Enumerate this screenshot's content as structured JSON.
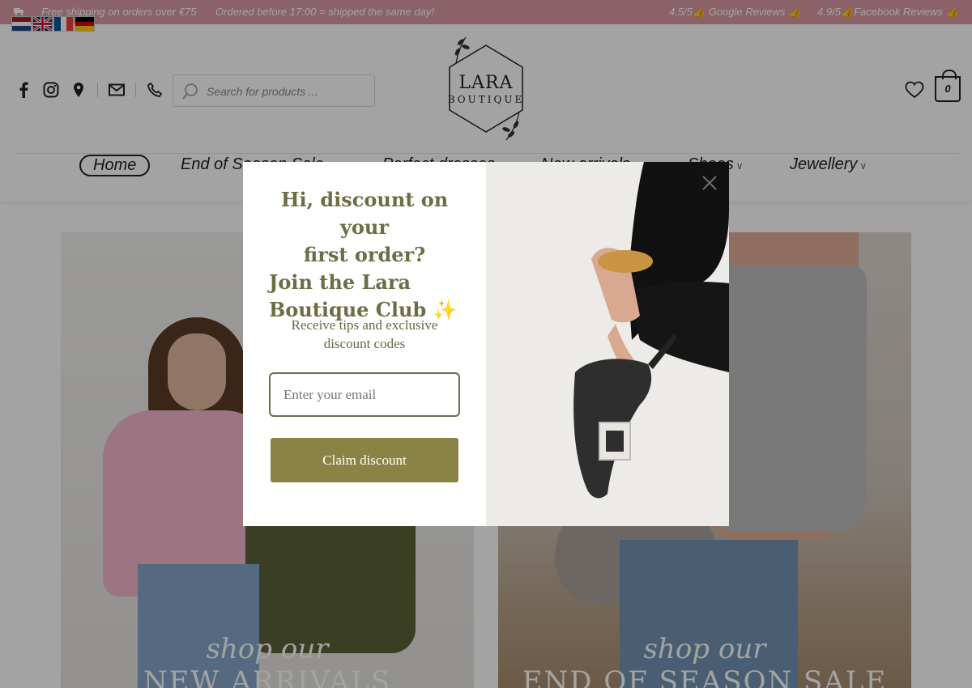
{
  "topbar": {
    "shipping": "Free shipping on orders over €75",
    "sameday": "Ordered before 17:00 = shipped the same day!",
    "google": "4,5/5👍 Google Reviews 👍",
    "facebook": "4.9/5👍Facebook Reviews 👍"
  },
  "header": {
    "search_placeholder": "Search for products ...",
    "logo_line1": "LARA",
    "logo_line2": "BOUTIQUE",
    "cart_count": "0"
  },
  "nav": [
    "Home",
    "End of Season Sale",
    "Perfect dresses",
    "New arrivals",
    "Shoes",
    "Jewellery"
  ],
  "hero": {
    "left_script": "shop our",
    "left_title": "NEW ARRIVALS",
    "right_script": "shop our",
    "right_title": "END OF SEASON SALE"
  },
  "popup": {
    "heading_line1": "Hi, discount on your",
    "heading_line2": "first order?",
    "heading_line3": "Join the Lara",
    "heading_line4": "Boutique Club ✨",
    "subtitle": "Receive tips and exclusive discount codes",
    "email_placeholder": "Enter your email",
    "button": "Claim discount"
  },
  "colors": {
    "topbar": "#d99aa6",
    "heading": "#6d6d45",
    "button": "#8b8345"
  }
}
